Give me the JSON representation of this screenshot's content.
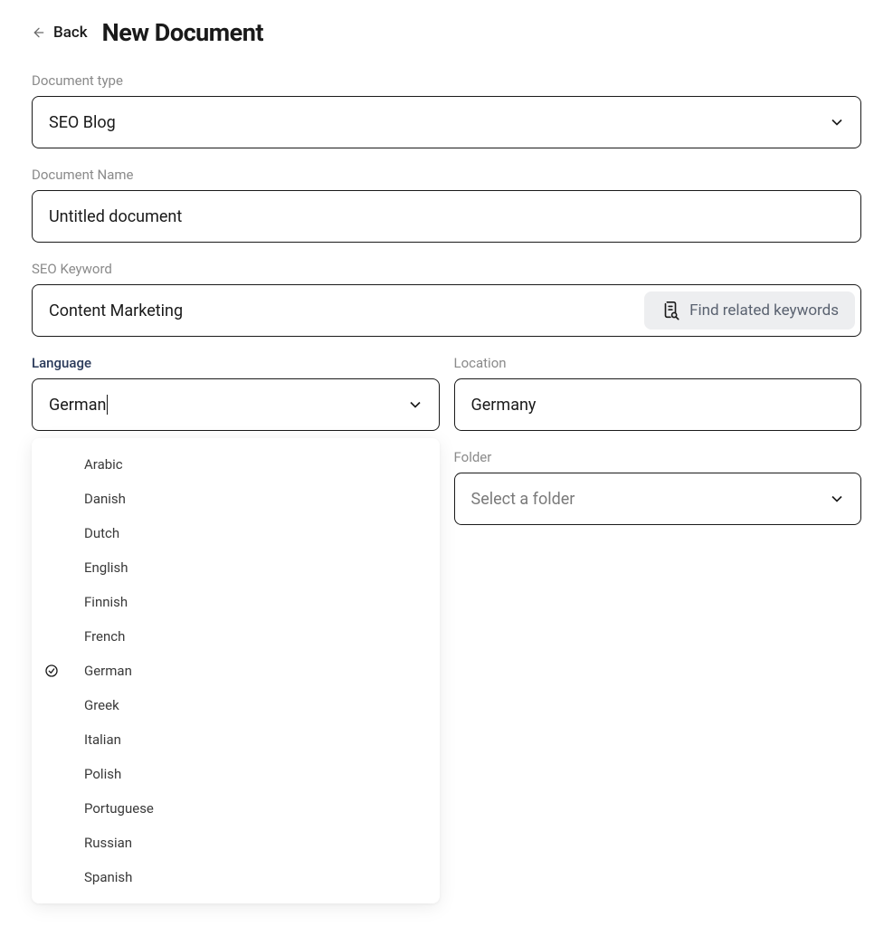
{
  "header": {
    "back_label": "Back",
    "title": "New Document"
  },
  "form": {
    "document_type": {
      "label": "Document type",
      "value": "SEO Blog"
    },
    "document_name": {
      "label": "Document Name",
      "value": "Untitled document"
    },
    "seo_keyword": {
      "label": "SEO Keyword",
      "value": "Content Marketing",
      "find_button": "Find related keywords"
    },
    "language": {
      "label": "Language",
      "value": "German",
      "options": [
        "Arabic",
        "Danish",
        "Dutch",
        "English",
        "Finnish",
        "French",
        "German",
        "Greek",
        "Italian",
        "Polish",
        "Portuguese",
        "Russian",
        "Spanish"
      ],
      "selected": "German"
    },
    "location": {
      "label": "Location",
      "value": "Germany"
    },
    "folder": {
      "label": "Folder",
      "placeholder": "Select a folder"
    }
  }
}
